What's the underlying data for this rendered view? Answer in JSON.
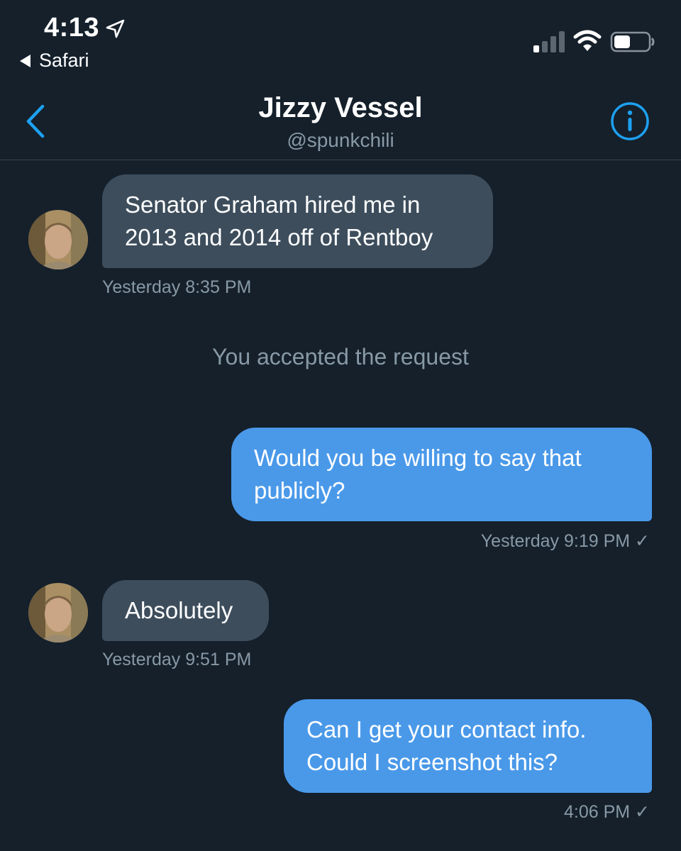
{
  "status_bar": {
    "time": "4:13",
    "back_app_label": "Safari"
  },
  "header": {
    "display_name": "Jizzy Vessel",
    "handle": "@spunkchili"
  },
  "messages": [
    {
      "direction": "incoming",
      "lines": [
        "Senator Graham hired me in",
        "2013 and 2014 off of Rentboy"
      ],
      "timestamp": "Yesterday 8:35 PM"
    },
    {
      "direction": "outgoing",
      "lines": [
        "Would you be willing to say that",
        "publicly?"
      ],
      "timestamp": "Yesterday 9:19 PM ✓"
    },
    {
      "direction": "incoming",
      "lines": [
        "Absolutely"
      ],
      "timestamp": "Yesterday 9:51 PM"
    },
    {
      "direction": "outgoing",
      "lines": [
        "Can I get your contact info.",
        "Could I screenshot this?"
      ],
      "timestamp": "4:06 PM ✓"
    }
  ],
  "system_note": "You accepted the request",
  "colors": {
    "background": "#15202b",
    "incoming_bubble": "#3d4d5c",
    "outgoing_bubble": "#4a99e9",
    "accent": "#1da1f2",
    "secondary_text": "#8899a6"
  },
  "icons": {
    "location": "location-arrow-icon",
    "signal": "cellular-signal-icon",
    "wifi": "wifi-icon",
    "battery": "battery-icon",
    "back": "chevron-left-icon",
    "info": "info-icon"
  }
}
